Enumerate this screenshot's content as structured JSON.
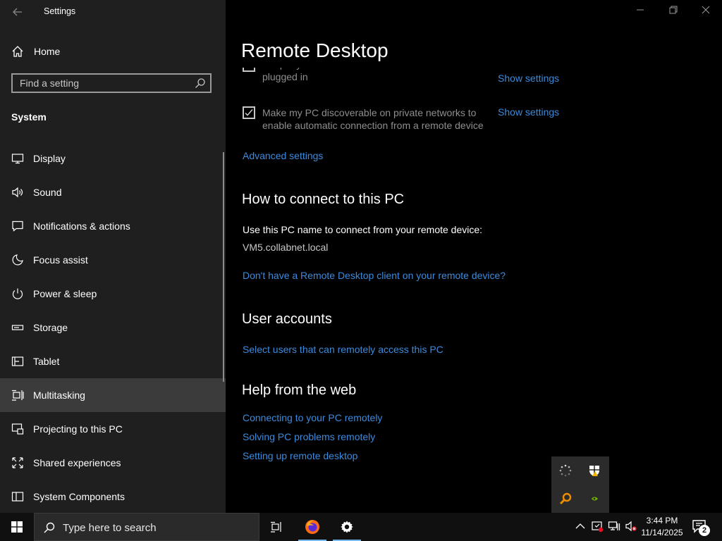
{
  "window": {
    "app_title": "Settings",
    "back_icon": "back-arrow-icon"
  },
  "sidebar": {
    "home_label": "Home",
    "search_placeholder": "Find a setting",
    "section_title": "System",
    "items": [
      {
        "label": "Display",
        "icon": "display-icon",
        "active": false
      },
      {
        "label": "Sound",
        "icon": "sound-icon",
        "active": false
      },
      {
        "label": "Notifications & actions",
        "icon": "notifications-icon",
        "active": false
      },
      {
        "label": "Focus assist",
        "icon": "moon-icon",
        "active": false
      },
      {
        "label": "Power & sleep",
        "icon": "power-icon",
        "active": false
      },
      {
        "label": "Storage",
        "icon": "storage-icon",
        "active": false
      },
      {
        "label": "Tablet",
        "icon": "tablet-icon",
        "active": false
      },
      {
        "label": "Multitasking",
        "icon": "multitasking-icon",
        "active": true
      },
      {
        "label": "Projecting to this PC",
        "icon": "projecting-icon",
        "active": false
      },
      {
        "label": "Shared experiences",
        "icon": "shared-experiences-icon",
        "active": false
      },
      {
        "label": "System Components",
        "icon": "system-components-icon",
        "active": false
      }
    ]
  },
  "main": {
    "page_title": "Remote Desktop",
    "options": [
      {
        "text": "Keep my PC awake for connections when it is plugged in",
        "checked": false,
        "link": "Show settings"
      },
      {
        "text": "Make my PC discoverable on private networks to enable automatic connection from a remote device",
        "checked": true,
        "link": "Show settings"
      }
    ],
    "advanced_link": "Advanced settings",
    "connect": {
      "heading": "How to connect to this PC",
      "instruction": "Use this PC name to connect from your remote device:",
      "pc_name": "VM5.collabnet.local",
      "client_link": "Don't have a Remote Desktop client on your remote device?"
    },
    "user_accounts": {
      "heading": "User accounts",
      "link": "Select users that can remotely access this PC"
    },
    "help": {
      "heading": "Help from the web",
      "links": [
        "Connecting to your PC remotely",
        "Solving PC problems remotely",
        "Setting up remote desktop"
      ]
    }
  },
  "taskbar": {
    "search_placeholder": "Type here to search",
    "time": "3:44 PM",
    "date": "11/14/2025",
    "notification_count": "2"
  },
  "colors": {
    "link": "#3b8bdf",
    "sidebar_bg": "#1f1f1f",
    "active_item": "#3b3b3b",
    "accent": "#76b9ed"
  }
}
